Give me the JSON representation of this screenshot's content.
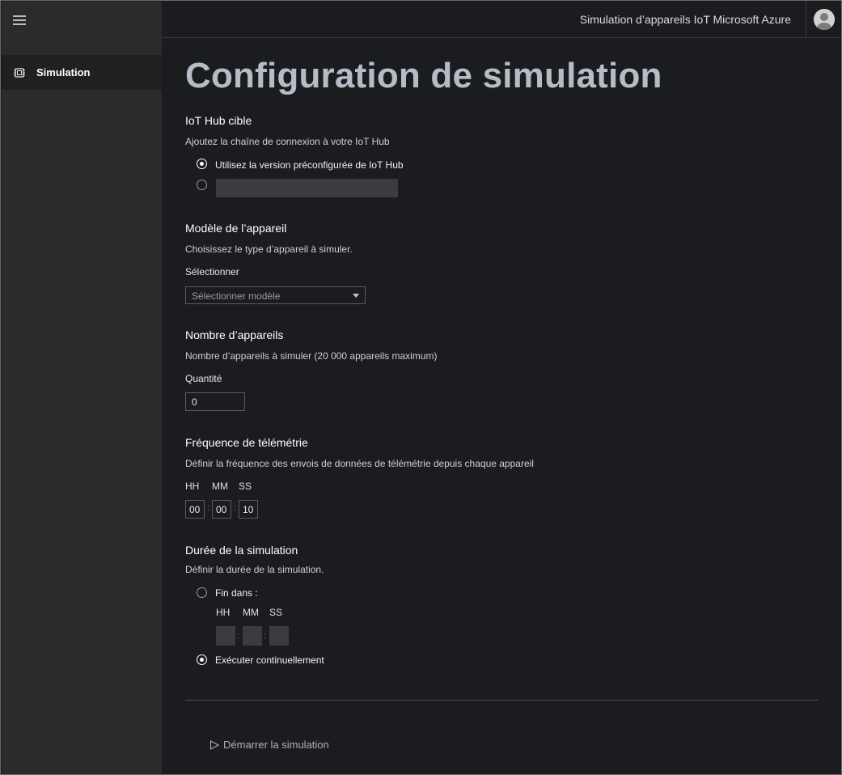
{
  "header": {
    "title": "Simulation d’appareils IoT Microsoft Azure"
  },
  "sidebar": {
    "items": [
      {
        "label": "Simulation",
        "icon": "chip-icon"
      }
    ]
  },
  "page": {
    "title": "Configuration de simulation"
  },
  "iot_hub": {
    "title": "IoT Hub cible",
    "description": "Ajoutez la chaîne de connexion à votre IoT Hub",
    "option_preconfigured": "Utilisez la version préconfigurée de IoT Hub",
    "connection_string_value": ""
  },
  "device_model": {
    "title": "Modèle de l’appareil",
    "description": "Choisissez le type d’appareil à simuler.",
    "select_label": "Sélectionner",
    "select_placeholder": "Sélectionner modèle"
  },
  "device_count": {
    "title": "Nombre d’appareils",
    "description": "Nombre d’appareils à simuler (20 000 appareils maximum)",
    "quantity_label": "Quantité",
    "quantity_value": "0"
  },
  "telemetry": {
    "title": "Fréquence de télémétrie",
    "description": "Définir la fréquence des envois de données de télémétrie depuis chaque appareil",
    "hh_label": "HH",
    "mm_label": "MM",
    "ss_label": "SS",
    "hh": "00",
    "mm": "00",
    "ss": "10",
    "separator": ":"
  },
  "duration": {
    "title": "Durée de la simulation",
    "description": "Définir la durée de la simulation.",
    "option_end_in": "Fin dans :",
    "hh_label": "HH",
    "mm_label": "MM",
    "ss_label": "SS",
    "separator": ":",
    "option_continuous": "Exécuter continuellement"
  },
  "footer": {
    "start_label": "Démarrer la simulation"
  },
  "colors": {
    "background": "#1b1c1f",
    "sidebar": "#2a2b2d",
    "title": "#b6bcc6",
    "field_fill": "#3a3c40"
  }
}
